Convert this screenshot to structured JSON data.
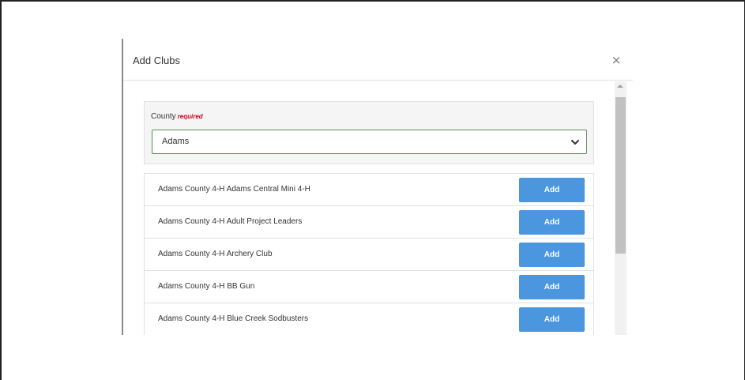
{
  "modal": {
    "title": "Add Clubs",
    "close_symbol": "×"
  },
  "county": {
    "label": "County",
    "required_label": "required",
    "selected": "Adams"
  },
  "clubs": [
    {
      "name": "Adams County 4-H Adams Central Mini 4-H",
      "button_label": "Add"
    },
    {
      "name": "Adams County 4-H Adult Project Leaders",
      "button_label": "Add"
    },
    {
      "name": "Adams County 4-H Archery Club",
      "button_label": "Add"
    },
    {
      "name": "Adams County 4-H BB Gun",
      "button_label": "Add"
    },
    {
      "name": "Adams County 4-H Blue Creek Sodbusters",
      "button_label": "Add"
    }
  ],
  "colors": {
    "accent": "#4a97e0",
    "required": "#d0021b",
    "select_border": "#5a8a5a"
  },
  "icons": {
    "close": "close-icon",
    "dropdown": "chevron-down-icon"
  }
}
